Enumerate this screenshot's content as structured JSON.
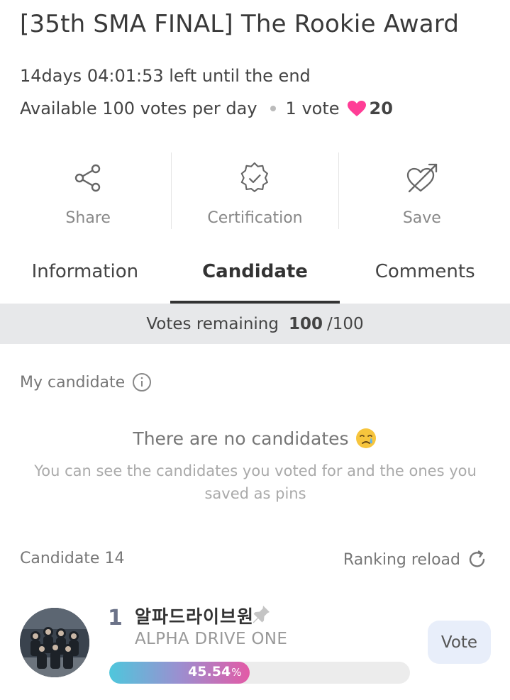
{
  "header": {
    "title": "[35th SMA FINAL] The Rookie Award",
    "time_left": "14days 04:01:53 left until the end",
    "daily_votes": "Available 100 votes per day",
    "vote_unit": "1 vote",
    "vote_cost": "20"
  },
  "actions": [
    {
      "label": "Share",
      "icon": "share-icon"
    },
    {
      "label": "Certification",
      "icon": "certification-badge-icon"
    },
    {
      "label": "Save",
      "icon": "heart-arrow-icon"
    }
  ],
  "tabs": [
    {
      "label": "Information",
      "active": false
    },
    {
      "label": "Candidate",
      "active": true
    },
    {
      "label": "Comments",
      "active": false
    }
  ],
  "votes_remaining": {
    "label": "Votes remaining",
    "value": "100",
    "total": "/100"
  },
  "my_candidate": {
    "label": "My candidate",
    "empty_title": "There are no candidates",
    "empty_desc": "You can see the candidates you voted for and the ones you saved as pins"
  },
  "candidates_header": {
    "count_label": "Candidate 14",
    "reload_label": "Ranking reload"
  },
  "candidates": [
    {
      "rank": "1",
      "name_kr": "알파드라이브원",
      "name_en": "ALPHA DRIVE ONE",
      "percent": "45.54",
      "percent_unit": "%",
      "share": 0.4554,
      "vote_label": "Vote"
    }
  ],
  "colors": {
    "heart": "#ff3d96",
    "progress_start": "#4ec7dc",
    "progress_end": "#e35aa6",
    "vote_button_bg": "#e8eefa"
  }
}
